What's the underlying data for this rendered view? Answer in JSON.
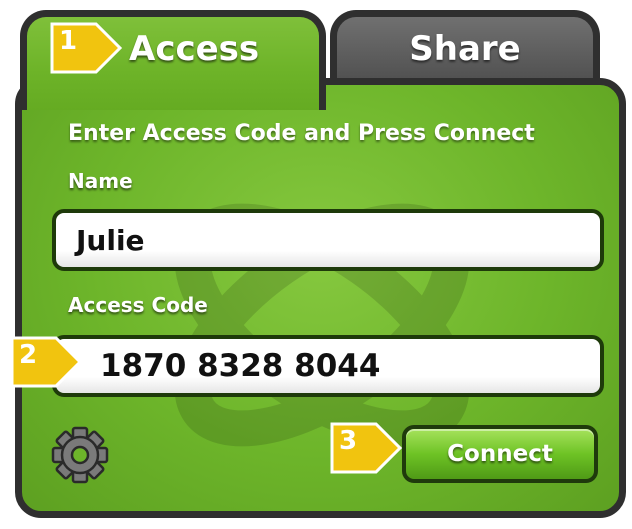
{
  "tabs": [
    {
      "label": "Access",
      "active": true
    },
    {
      "label": "Share",
      "active": false
    }
  ],
  "instructions": "Enter Access Code and Press Connect",
  "name_field": {
    "label": "Name",
    "value": "Julie"
  },
  "code_field": {
    "label": "Access Code",
    "value": "1870 8328 8044"
  },
  "connect_button": {
    "label": "Connect"
  },
  "settings": {
    "icon": "gear-icon"
  },
  "steps": [
    "1",
    "2",
    "3"
  ],
  "colors": {
    "panel_green": "#6db52a",
    "border_dark": "#2f2f2f",
    "step_yellow": "#f1c40f",
    "share_tab_gray": "#555555"
  }
}
